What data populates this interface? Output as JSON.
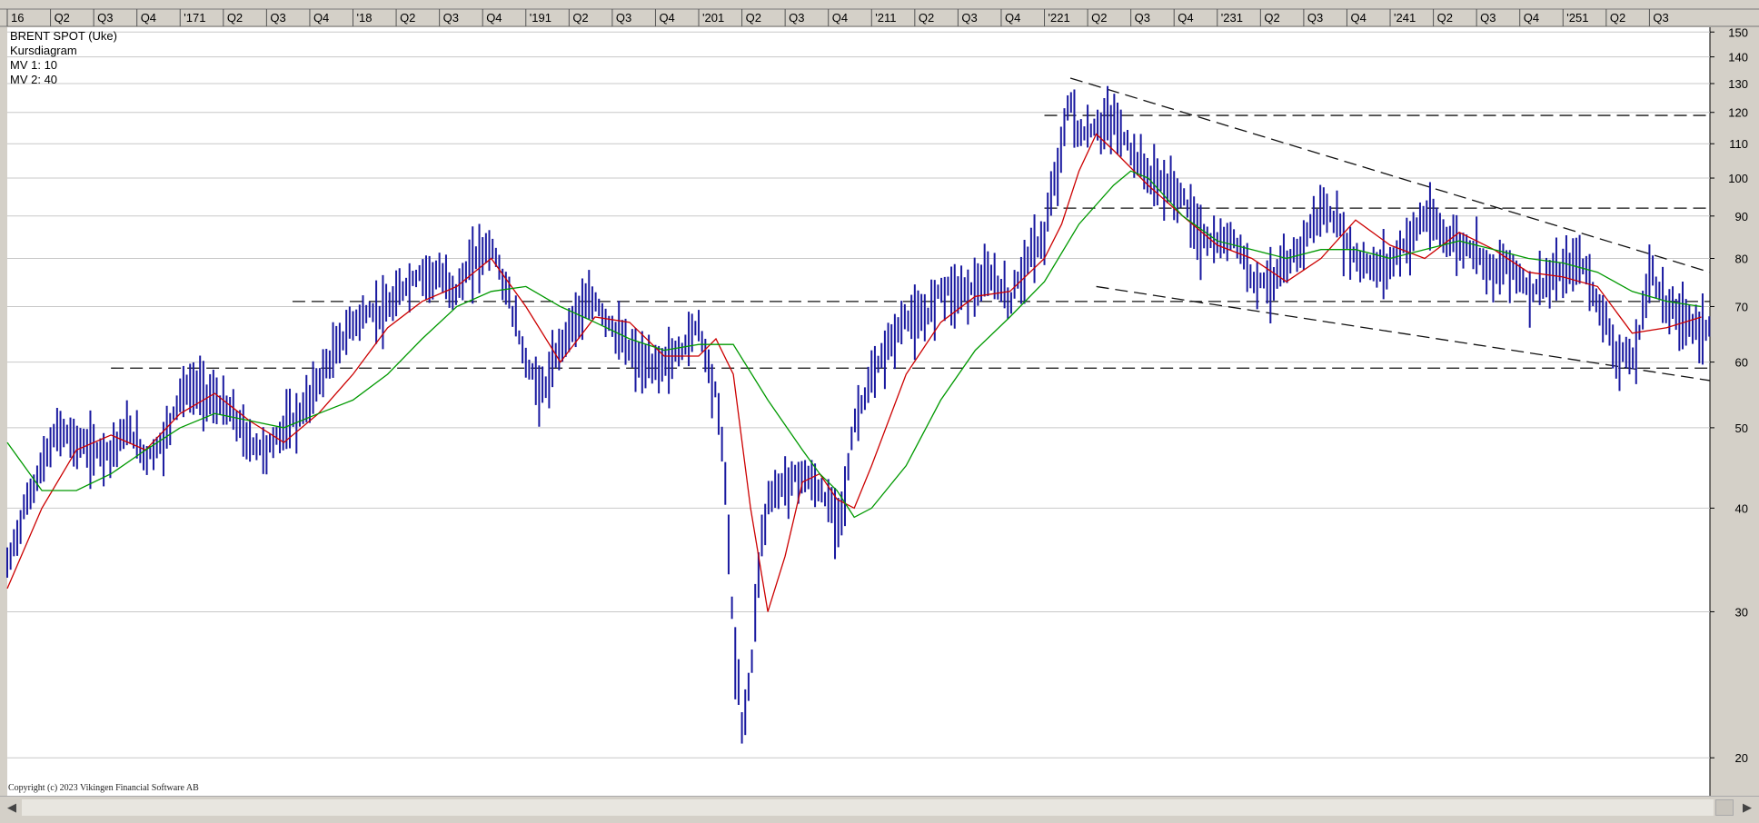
{
  "legend": {
    "title": "BRENT SPOT (Uke)",
    "subtitle": "Kursdiagram",
    "mv1": "MV 1: 10",
    "mv2": "MV 2: 40"
  },
  "copyright": "Copyright (c) 2023 Vikingen Financial Software AB",
  "scrollbar": {
    "left_icon": "arrow-left-icon",
    "right_icon": "arrow-right-icon"
  },
  "colors": {
    "price_bars": "#1a1aa0",
    "mv1": "#cc0000",
    "mv2": "#009900",
    "background": "#ffffff",
    "grid": "#c8c8c8"
  },
  "chart_data": {
    "type": "line",
    "title": "BRENT SPOT (Uke)",
    "scale": "log",
    "ylim": [
      18,
      152
    ],
    "yticks": [
      20,
      30,
      40,
      50,
      60,
      70,
      80,
      90,
      100,
      110,
      120,
      130,
      140,
      150
    ],
    "xticks": [
      "16",
      "Q2",
      "Q3",
      "Q4",
      "'171",
      "Q2",
      "Q3",
      "Q4",
      "'18",
      "Q2",
      "Q3",
      "Q4",
      "'191",
      "Q2",
      "Q3",
      "Q4",
      "'201",
      "Q2",
      "Q3",
      "Q4",
      "'211",
      "Q2",
      "Q3",
      "Q4",
      "'221",
      "Q2",
      "Q3",
      "Q4",
      "'231",
      "Q2",
      "Q3",
      "Q4",
      "'241",
      "Q2",
      "Q3",
      "Q4",
      "'251",
      "Q2",
      "Q3"
    ],
    "x_range": [
      2016.0,
      2025.85
    ],
    "grid": true,
    "series": [
      {
        "name": "BRENT SPOT (Uke)",
        "x": [
          2016.0,
          2016.1,
          2016.2,
          2016.3,
          2016.4,
          2016.5,
          2016.6,
          2016.7,
          2016.8,
          2016.9,
          2017.0,
          2017.1,
          2017.2,
          2017.3,
          2017.4,
          2017.5,
          2017.6,
          2017.7,
          2017.8,
          2017.9,
          2018.0,
          2018.1,
          2018.2,
          2018.3,
          2018.4,
          2018.5,
          2018.6,
          2018.7,
          2018.8,
          2018.9,
          2019.0,
          2019.1,
          2019.2,
          2019.3,
          2019.4,
          2019.5,
          2019.6,
          2019.7,
          2019.8,
          2019.9,
          2020.0,
          2020.05,
          2020.1,
          2020.15,
          2020.2,
          2020.25,
          2020.3,
          2020.35,
          2020.4,
          2020.5,
          2020.6,
          2020.7,
          2020.8,
          2020.85,
          2020.9,
          2021.0,
          2021.1,
          2021.2,
          2021.3,
          2021.4,
          2021.5,
          2021.6,
          2021.7,
          2021.8,
          2021.9,
          2022.0,
          2022.1,
          2022.15,
          2022.2,
          2022.3,
          2022.4,
          2022.5,
          2022.6,
          2022.7,
          2022.8,
          2022.9,
          2023.0,
          2023.1,
          2023.2,
          2023.3,
          2023.4,
          2023.5,
          2023.6,
          2023.7,
          2023.8,
          2023.9,
          2024.0,
          2024.1,
          2024.2,
          2024.3,
          2024.4,
          2024.5,
          2024.6,
          2024.7,
          2024.8,
          2024.9,
          2025.0,
          2025.1,
          2025.2,
          2025.25,
          2025.3,
          2025.4,
          2025.45,
          2025.5,
          2025.6,
          2025.7,
          2025.8
        ],
        "y": [
          34,
          40,
          45,
          50,
          48,
          47,
          47,
          50,
          46,
          48,
          55,
          56,
          54,
          52,
          48,
          47,
          50,
          52,
          57,
          62,
          67,
          69,
          69,
          74,
          77,
          76,
          73,
          80,
          83,
          72,
          60,
          55,
          63,
          69,
          71,
          66,
          62,
          59,
          60,
          62,
          67,
          60,
          55,
          45,
          28,
          22,
          25,
          35,
          41,
          43,
          44,
          42,
          39,
          42,
          51,
          57,
          63,
          68,
          67,
          74,
          73,
          74,
          76,
          71,
          80,
          85,
          110,
          125,
          112,
          115,
          118,
          108,
          101,
          98,
          95,
          85,
          83,
          85,
          76,
          75,
          78,
          84,
          92,
          88,
          80,
          78,
          79,
          84,
          90,
          86,
          83,
          82,
          77,
          79,
          73,
          75,
          77,
          80,
          71,
          67,
          62,
          60,
          66,
          78,
          70,
          68,
          66
        ]
      },
      {
        "name": "MV 1: 10",
        "x": [
          2016.0,
          2016.2,
          2016.4,
          2016.6,
          2016.8,
          2017.0,
          2017.2,
          2017.4,
          2017.6,
          2017.8,
          2018.0,
          2018.2,
          2018.4,
          2018.6,
          2018.8,
          2019.0,
          2019.2,
          2019.4,
          2019.6,
          2019.8,
          2020.0,
          2020.1,
          2020.2,
          2020.3,
          2020.4,
          2020.5,
          2020.6,
          2020.7,
          2020.8,
          2020.9,
          2021.0,
          2021.2,
          2021.4,
          2021.6,
          2021.8,
          2022.0,
          2022.1,
          2022.2,
          2022.3,
          2022.4,
          2022.6,
          2022.8,
          2023.0,
          2023.2,
          2023.4,
          2023.6,
          2023.8,
          2024.0,
          2024.2,
          2024.4,
          2024.6,
          2024.8,
          2025.0,
          2025.2,
          2025.4,
          2025.6,
          2025.8
        ],
        "y": [
          32,
          40,
          47,
          49,
          47,
          52,
          55,
          51,
          48,
          52,
          58,
          66,
          71,
          74,
          80,
          70,
          60,
          68,
          67,
          61,
          61,
          64,
          58,
          40,
          30,
          35,
          43,
          44,
          41,
          40,
          45,
          58,
          67,
          72,
          73,
          80,
          88,
          102,
          113,
          108,
          98,
          90,
          83,
          80,
          75,
          80,
          89,
          83,
          80,
          86,
          82,
          77,
          76,
          74,
          65,
          66,
          68
        ]
      },
      {
        "name": "MV 2: 40",
        "x": [
          2016.0,
          2016.2,
          2016.4,
          2016.6,
          2016.8,
          2017.0,
          2017.2,
          2017.4,
          2017.6,
          2017.8,
          2018.0,
          2018.2,
          2018.4,
          2018.6,
          2018.8,
          2019.0,
          2019.2,
          2019.4,
          2019.6,
          2019.8,
          2020.0,
          2020.2,
          2020.4,
          2020.6,
          2020.7,
          2020.8,
          2020.9,
          2021.0,
          2021.2,
          2021.4,
          2021.6,
          2021.8,
          2022.0,
          2022.2,
          2022.4,
          2022.5,
          2022.6,
          2022.8,
          2023.0,
          2023.2,
          2023.4,
          2023.6,
          2023.8,
          2024.0,
          2024.2,
          2024.4,
          2024.6,
          2024.8,
          2025.0,
          2025.2,
          2025.4,
          2025.6,
          2025.8
        ],
        "y": [
          48,
          42,
          42,
          44,
          47,
          50,
          52,
          51,
          50,
          52,
          54,
          58,
          64,
          70,
          73,
          74,
          70,
          67,
          64,
          62,
          63,
          63,
          54,
          47,
          44,
          42,
          39,
          40,
          45,
          54,
          62,
          68,
          75,
          88,
          98,
          102,
          100,
          90,
          84,
          82,
          80,
          82,
          82,
          80,
          82,
          84,
          82,
          80,
          79,
          77,
          73,
          71,
          70
        ]
      }
    ],
    "annotations": [
      {
        "type": "hline",
        "y": 119,
        "x_from": 2022.0
      },
      {
        "type": "hline",
        "y": 92,
        "x_from": 2022.0
      },
      {
        "type": "hline",
        "y": 71,
        "x_from": 2017.65
      },
      {
        "type": "hline",
        "y": 59,
        "x_from": 2016.6
      },
      {
        "type": "trendline",
        "points": [
          [
            2022.15,
            132
          ],
          [
            2025.85,
            77
          ]
        ]
      },
      {
        "type": "trendline",
        "points": [
          [
            2022.3,
            74
          ],
          [
            2025.85,
            57
          ]
        ]
      }
    ]
  }
}
